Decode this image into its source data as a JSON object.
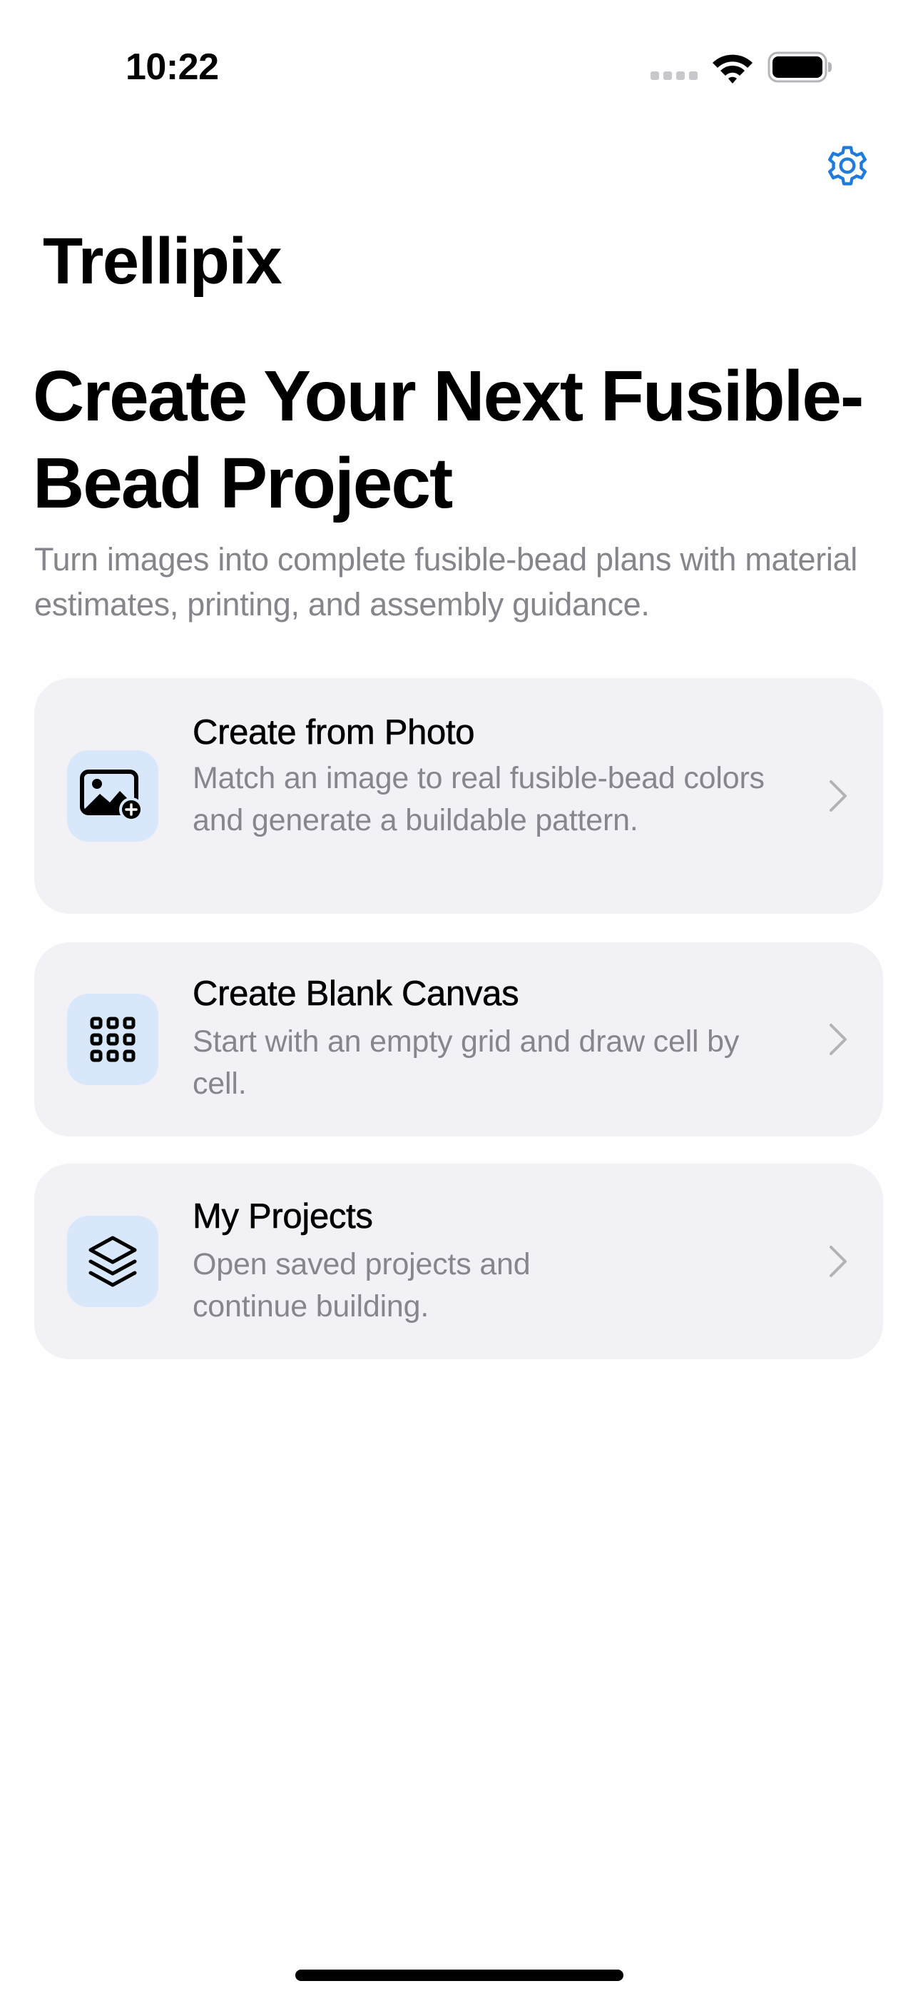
{
  "status_bar": {
    "time": "10:22"
  },
  "header": {
    "settings_icon": "gear-icon",
    "accent_color": "#1f7bdc",
    "app_title": "Trellipix"
  },
  "hero": {
    "headline": "Create Your Next Fusible-Bead Project",
    "subtitle": "Turn images into complete fusible-bead plans with material estimates, printing, and assembly guidance."
  },
  "actions": [
    {
      "title": "Create from Photo",
      "description": "Match an image to real fusible-bead colors and generate a buildable pattern.",
      "icon": "photo-add-icon"
    },
    {
      "title": "Create Blank Canvas",
      "description": "Start with an empty grid and draw cell by cell.",
      "icon": "grid-icon"
    },
    {
      "title": "My Projects",
      "description": "Open saved projects and continue building.",
      "icon": "layers-icon"
    }
  ],
  "colors": {
    "card_background": "#f1f1f6",
    "icon_tile_background": "#d9e7fb",
    "secondary_text": "#86868c"
  }
}
